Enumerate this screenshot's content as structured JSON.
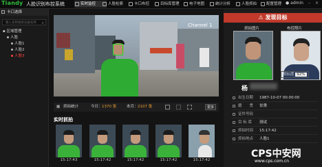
{
  "app": {
    "logo": "Tiandy",
    "title": "人脸识别布控系统"
  },
  "tabs": [
    {
      "label": "实时监控"
    },
    {
      "label": "人脸检索"
    },
    {
      "label": "卡口布控"
    },
    {
      "label": "目标库管理"
    },
    {
      "label": "电子地图"
    },
    {
      "label": "统计分析"
    },
    {
      "label": "人脸抓拍"
    },
    {
      "label": "配置管理"
    }
  ],
  "user": {
    "name": "admin"
  },
  "window": {
    "min": "–",
    "close": "×"
  },
  "sidebar": {
    "header": "卡口选择",
    "search_placeholder": "输入名称搜索设备名称",
    "tree": [
      {
        "label": "区域管理"
      },
      {
        "label": "人脸"
      },
      {
        "label": "人脸1"
      },
      {
        "label": "人脸2"
      },
      {
        "label": "人脸3"
      }
    ]
  },
  "video": {
    "channel": "Channel 1"
  },
  "stats": {
    "snap_label": "抓拍统计",
    "today_label": "今日：",
    "today_count": "1370 张",
    "month_label": "本月：",
    "month_count": "2107 张",
    "more": "更多"
  },
  "realtime": {
    "title": "实时抓拍",
    "times": [
      "15:17:43",
      "15:17:42",
      "15:17:42",
      "15:17:42",
      "15:17:42"
    ]
  },
  "alert": {
    "header": "发现目标",
    "snap_label": "抓拍图片",
    "target_label": "布控照片",
    "similarity_label": "相似度",
    "similarity": "92%",
    "name": "杨",
    "fields": [
      {
        "k": "出生日期",
        "v": "1987-10-07 00:00:00"
      },
      {
        "k": "籍　　贯",
        "v": "甘肃"
      },
      {
        "k": "证件号码",
        "v": ""
      },
      {
        "k": "目 标 库",
        "v": "测试"
      },
      {
        "k": "抓拍时间",
        "v": "15:17:42"
      },
      {
        "k": "抓拍地点",
        "v": "人脸1"
      }
    ]
  },
  "watermark": {
    "brand": "CPS中安网",
    "url": "www.cps.com.cn"
  }
}
